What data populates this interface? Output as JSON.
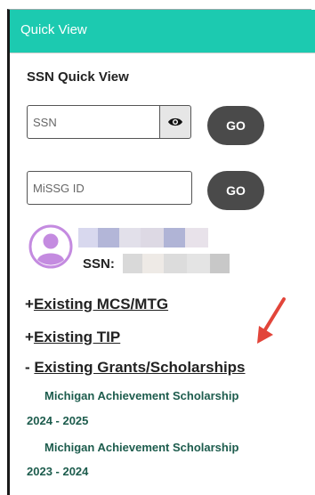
{
  "header": {
    "title": "Quick View"
  },
  "ssn_quick_view": {
    "title": "SSN Quick View",
    "ssn_placeholder": "SSN",
    "ssn_value": "",
    "go_label": "GO",
    "missg_placeholder": "MiSSG ID",
    "missg_value": "",
    "missg_go_label": "GO"
  },
  "student": {
    "ssn_label": "SSN:"
  },
  "sections": [
    {
      "prefix": "+",
      "label": "Existing MCS/MTG"
    },
    {
      "prefix": "+",
      "label": "Existing TIP"
    },
    {
      "prefix": "- ",
      "label": "Existing Grants/Scholarships"
    }
  ],
  "grants": [
    {
      "name": "Michigan Achievement Scholarship",
      "years": "2024 - 2025"
    },
    {
      "name": "Michigan Achievement Scholarship",
      "years": "2023 - 2024"
    }
  ],
  "colors": {
    "header_bg": "#1ccab0",
    "go_button": "#4a4a4a",
    "grant_text": "#1d5c4d",
    "avatar": "#c48be0",
    "annotation_arrow": "#e2453a"
  }
}
